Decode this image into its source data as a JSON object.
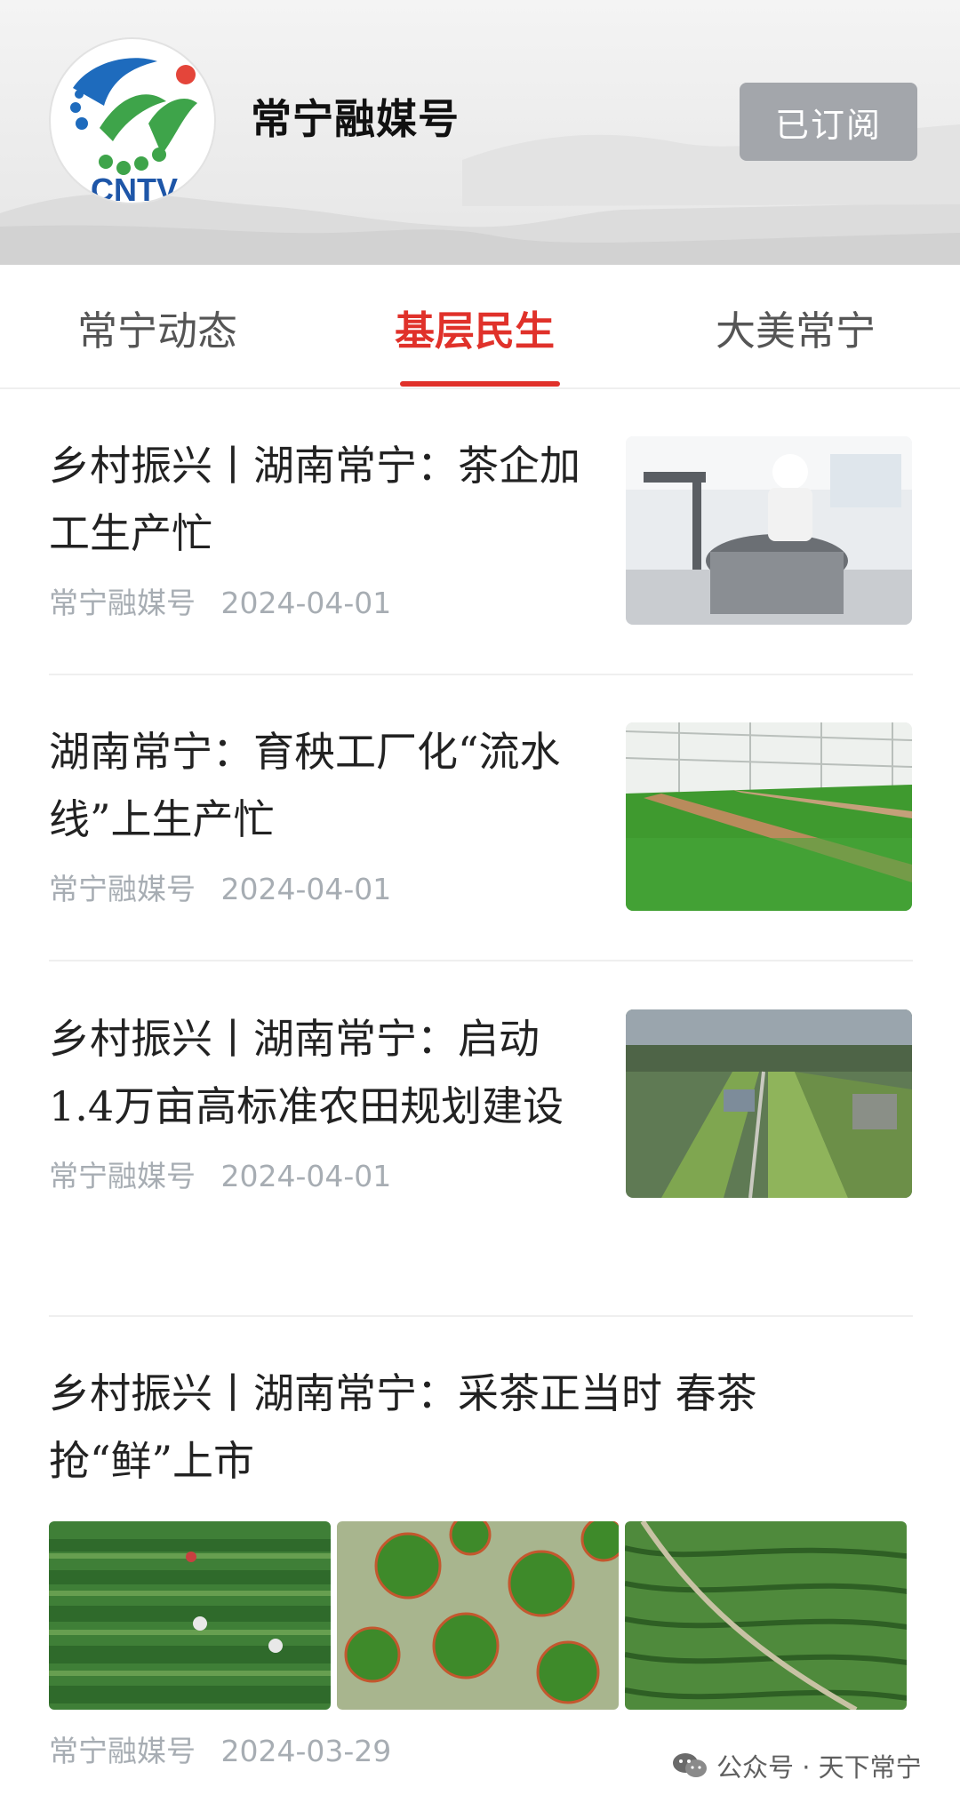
{
  "header": {
    "logo_text": "CNTV",
    "channel_name": "常宁融媒号",
    "subscribe_label": "已订阅"
  },
  "tabs": [
    {
      "label": "常宁动态",
      "active": false
    },
    {
      "label": "基层民生",
      "active": true
    },
    {
      "label": "大美常宁",
      "active": false
    }
  ],
  "articles": [
    {
      "title": "乡村振兴丨湖南常宁：茶企加工生产忙",
      "source": "常宁融媒号",
      "date": "2024-04-01"
    },
    {
      "title": "湖南常宁：育秧工厂化“流水线”上生产忙",
      "source": "常宁融媒号",
      "date": "2024-04-01"
    },
    {
      "title": "乡村振兴丨湖南常宁：启动1.4万亩高标准农田规划建设",
      "source": "常宁融媒号",
      "date": "2024-04-01"
    },
    {
      "title": "乡村振兴丨湖南常宁：采茶正当时 春茶抢“鲜”上市",
      "source": "常宁融媒号",
      "date": "2024-03-29"
    }
  ],
  "watermark": "公众号 · 天下常宁",
  "colors": {
    "accent": "#e0312a",
    "meta": "#a7adb3",
    "subscribe_bg": "#a3a6ab"
  }
}
